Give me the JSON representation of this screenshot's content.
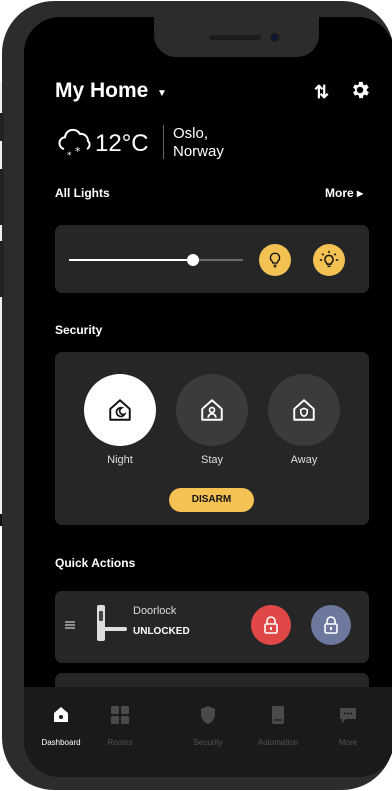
{
  "header": {
    "title": "My Home"
  },
  "weather": {
    "temperature": "12°C",
    "city_line1": "Oslo,",
    "city_line2": "Norway"
  },
  "lights": {
    "section_label": "All Lights",
    "more_label": "More ▸",
    "brightness": 0.71
  },
  "security": {
    "section_label": "Security",
    "modes": [
      {
        "label": "Night",
        "selected": true
      },
      {
        "label": "Stay",
        "selected": false
      },
      {
        "label": "Away",
        "selected": false
      }
    ],
    "disarm_label": "DISARM"
  },
  "quick_actions": {
    "section_label": "Quick Actions",
    "device_name": "Doorlock",
    "device_status": "UNLOCKED"
  },
  "tabs": [
    {
      "label": "Dashboard",
      "icon": "home-icon",
      "active": true
    },
    {
      "label": "Rooms",
      "icon": "grid-icon",
      "active": false
    },
    {
      "label": "Security",
      "icon": "shield-icon",
      "active": false
    },
    {
      "label": "Automation",
      "icon": "device-icon",
      "active": false
    },
    {
      "label": "More",
      "icon": "chat-icon",
      "active": false
    }
  ],
  "colors": {
    "accent": "#f3c252",
    "lock_red": "#e04848",
    "lock_blue": "#6c789e",
    "card": "#262626"
  }
}
